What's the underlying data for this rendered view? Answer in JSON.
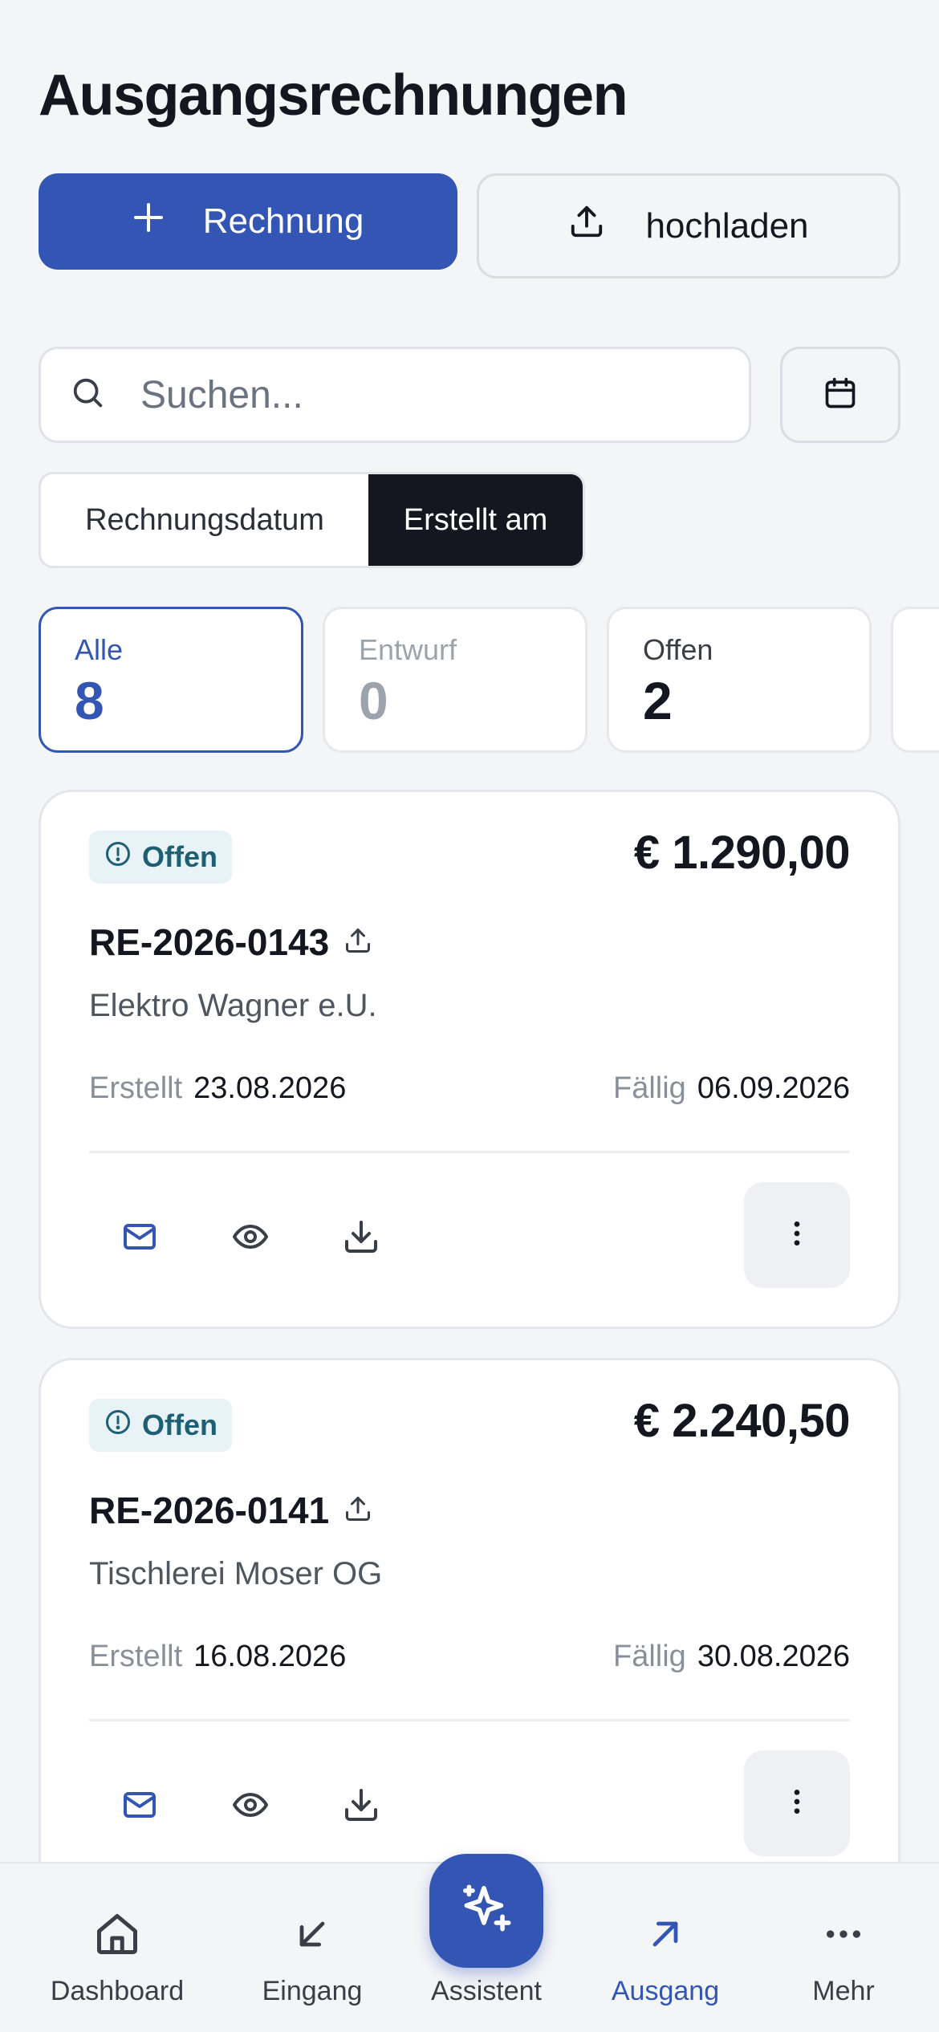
{
  "header": {
    "title": "Ausgangsrechnungen"
  },
  "actions": {
    "new_invoice_label": "Rechnung",
    "upload_label": "hochladen"
  },
  "search": {
    "placeholder": "Suchen..."
  },
  "date_toggle": {
    "options": [
      "Rechnungsdatum",
      "Erstellt am"
    ],
    "selected": "Erstellt am"
  },
  "stats": [
    {
      "label": "Alle",
      "count": "8",
      "state": "active"
    },
    {
      "label": "Entwurf",
      "count": "0",
      "state": "muted"
    },
    {
      "label": "Offen",
      "count": "2",
      "state": "normal"
    }
  ],
  "invoices": [
    {
      "status": "Offen",
      "amount": "€ 1.290,00",
      "number": "RE-2026-0143",
      "customer": "Elektro Wagner e.U.",
      "created_label": "Erstellt",
      "created": "23.08.2026",
      "due_label": "Fällig",
      "due": "06.09.2026"
    },
    {
      "status": "Offen",
      "amount": "€ 2.240,50",
      "number": "RE-2026-0141",
      "customer": "Tischlerei Moser OG",
      "created_label": "Erstellt",
      "created": "16.08.2026",
      "due_label": "Fällig",
      "due": "30.08.2026"
    }
  ],
  "nav": {
    "items": [
      {
        "label": "Dashboard",
        "icon": "home-icon"
      },
      {
        "label": "Eingang",
        "icon": "arrow-down-left-icon"
      },
      {
        "label": "Assistent",
        "icon": "sparkles-icon"
      },
      {
        "label": "Ausgang",
        "icon": "arrow-up-right-icon"
      },
      {
        "label": "Mehr",
        "icon": "more-horizontal-icon"
      }
    ],
    "active": "Ausgang"
  },
  "colors": {
    "primary": "#3355b4",
    "dark": "#14171f",
    "status_open_bg": "#e8f3f7",
    "status_open_text": "#1f5f74",
    "background": "#f4f5f7"
  }
}
